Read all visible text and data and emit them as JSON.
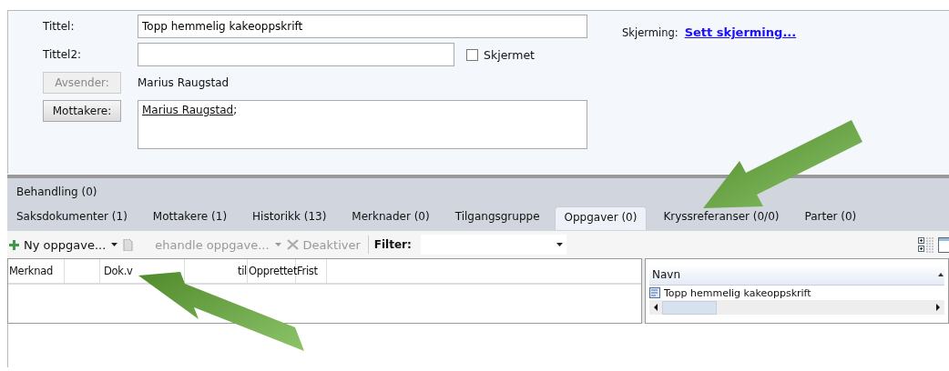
{
  "form": {
    "title": {
      "label": "Tittel:",
      "value": "Topp hemmelig kakeoppskrift"
    },
    "title2": {
      "label": "Tittel2:"
    },
    "screened": {
      "label": "Skjermet",
      "checked": false
    },
    "sender": {
      "button": "Avsender:",
      "disabled": true,
      "value": "Marius Raugstad"
    },
    "recipients": {
      "button": "Mottakere:",
      "disabled": false,
      "link": "Marius Raugstad",
      "separator": ";"
    },
    "screening": {
      "label": "Skjerming:",
      "link": "Sett skjerming..."
    }
  },
  "section_label": "Behandling (0)",
  "tabs": [
    {
      "label": "Saksdokumenter (1)",
      "selected": false
    },
    {
      "label": "Mottakere (1)",
      "selected": false
    },
    {
      "label": "Historikk (13)",
      "selected": false
    },
    {
      "label": "Merknader (0)",
      "selected": false
    },
    {
      "label": "Tilgangsgruppe",
      "selected": false
    },
    {
      "label": "Oppgaver (0)",
      "selected": true
    },
    {
      "label": "Kryssreferanser (0/0)",
      "selected": false
    },
    {
      "label": "Parter (0)",
      "selected": false
    }
  ],
  "toolbar": {
    "new_task": {
      "label": "Ny oppgave...",
      "disabled": false
    },
    "process_task": {
      "label": "ehandle oppgave...",
      "disabled": true
    },
    "deactivate": {
      "label": "Deaktiver",
      "disabled": true
    },
    "filter": {
      "label": "Filter:"
    }
  },
  "task_grid": {
    "columns": [
      "Merknad",
      "Dok.v",
      "til",
      "Opprettet",
      "Frist"
    ]
  },
  "document_list": {
    "column": "Navn",
    "rows": [
      {
        "name": "Topp hemmelig kakeoppskrift"
      }
    ]
  }
}
